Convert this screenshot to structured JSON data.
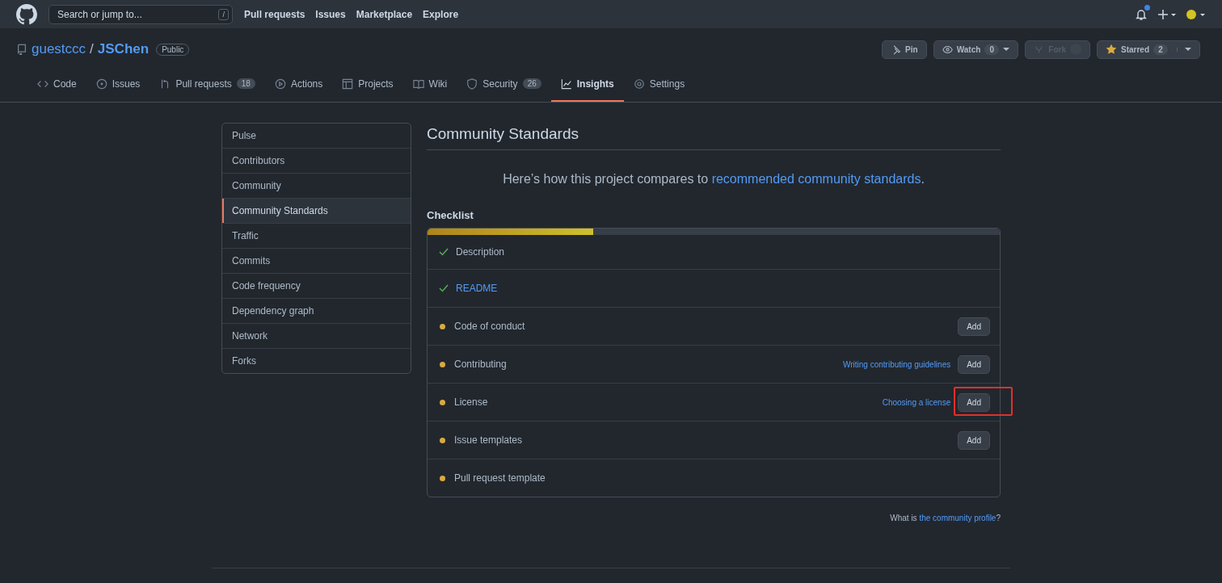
{
  "header": {
    "search": {
      "placeholder": "Search or jump to...",
      "shortcut": "/"
    },
    "nav": [
      "Pull requests",
      "Issues",
      "Marketplace",
      "Explore"
    ],
    "notifications_unread": true
  },
  "repo": {
    "owner": "guestccc",
    "separator": "/",
    "name": "JSChen",
    "visibility": "Public",
    "actions": [
      {
        "kind": "pin",
        "label": "Pin",
        "disabled": false
      },
      {
        "kind": "watch",
        "label": "Watch",
        "count": "0",
        "disabled": false
      },
      {
        "kind": "fork",
        "label": "Fork",
        "disabled": true
      },
      {
        "kind": "star",
        "label": "Starred",
        "count": "2",
        "disabled": false
      }
    ]
  },
  "tabs": [
    {
      "kind": "code",
      "label": "Code",
      "selected": false
    },
    {
      "kind": "issues",
      "label": "Issues",
      "selected": false
    },
    {
      "kind": "pulls",
      "label": "Pull requests",
      "counter": "18",
      "selected": false
    },
    {
      "kind": "actions",
      "label": "Actions",
      "selected": false
    },
    {
      "kind": "projects",
      "label": "Projects",
      "selected": false
    },
    {
      "kind": "wiki",
      "label": "Wiki",
      "selected": false
    },
    {
      "kind": "security",
      "label": "Security",
      "counter": "26",
      "selected": false
    },
    {
      "kind": "insights",
      "label": "Insights",
      "selected": true
    },
    {
      "kind": "settings",
      "label": "Settings",
      "selected": false
    }
  ],
  "sidebar": {
    "items": [
      {
        "label": "Pulse",
        "selected": false
      },
      {
        "label": "Contributors",
        "selected": false
      },
      {
        "label": "Community",
        "selected": false
      },
      {
        "label": "Community Standards",
        "selected": true
      },
      {
        "label": "Traffic",
        "selected": false
      },
      {
        "label": "Commits",
        "selected": false
      },
      {
        "label": "Code frequency",
        "selected": false
      },
      {
        "label": "Dependency graph",
        "selected": false
      },
      {
        "label": "Network",
        "selected": false
      },
      {
        "label": "Forks",
        "selected": false
      }
    ]
  },
  "main": {
    "title": "Community Standards",
    "intro": {
      "text": "Here’s how this project compares to ",
      "link": "recommended community standards",
      "end": "."
    },
    "checklist": {
      "heading": "Checklist",
      "level": 0.29,
      "items": [
        {
          "label": "Description",
          "done": true,
          "linked": false
        },
        {
          "label": "README",
          "done": true,
          "linked": true
        },
        {
          "label": "Code of conduct",
          "done": false,
          "linked": false,
          "action": "Add"
        },
        {
          "label": "Contributing",
          "done": false,
          "linked": false,
          "help": "Writing contributing guidelines",
          "action": "Add"
        },
        {
          "label": "License",
          "done": false,
          "linked": false,
          "help": "Choosing a license",
          "action": "Add",
          "annotated": true
        },
        {
          "label": "Issue templates",
          "done": false,
          "linked": false,
          "action": "Add"
        },
        {
          "label": "Pull request template",
          "done": false,
          "linked": false
        }
      ]
    },
    "footer": {
      "text": "What is ",
      "link": "the community profile",
      "end": "?"
    }
  }
}
